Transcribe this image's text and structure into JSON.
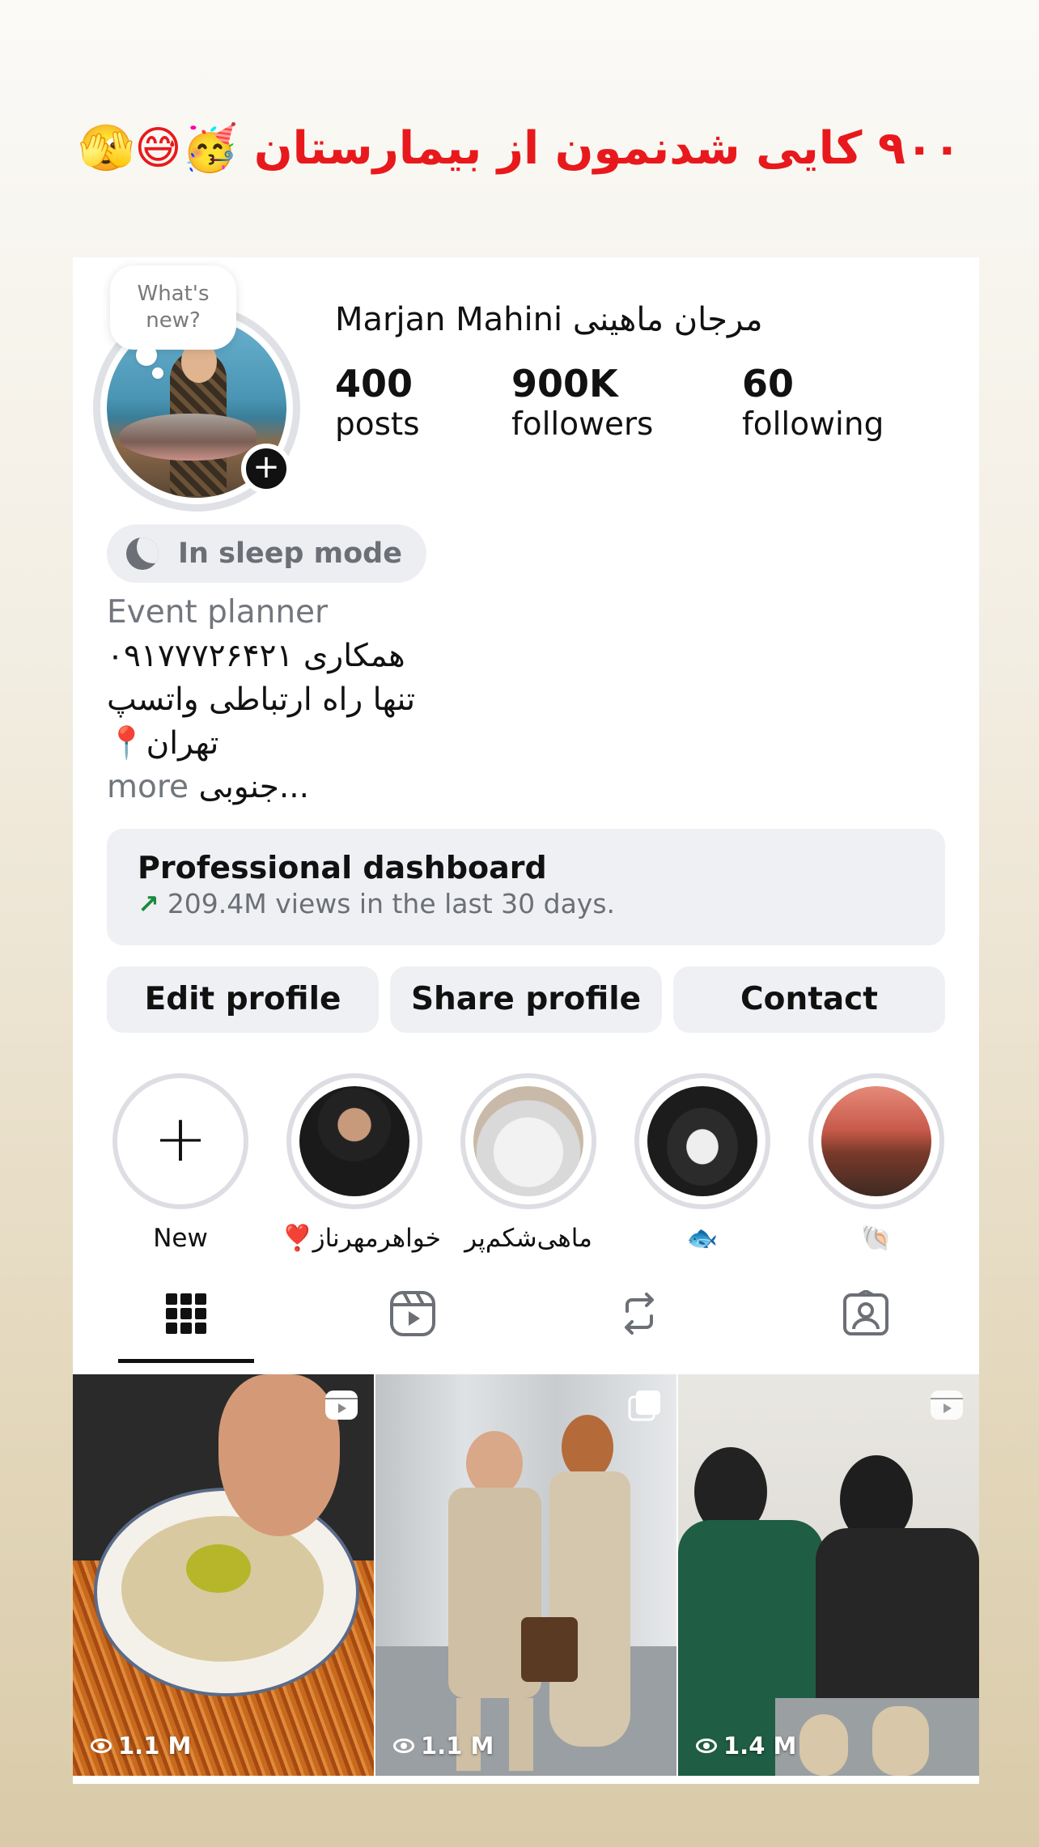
{
  "story": {
    "caption": "۹۰۰ کایی شدنمون از بیمارستان 🥳😅🫣"
  },
  "profile": {
    "note_text": "What's new?",
    "name": "Marjan Mahini مرجان ماهینی",
    "stats": [
      {
        "value": "400",
        "label": "posts"
      },
      {
        "value": "900K",
        "label": "followers"
      },
      {
        "value": "60",
        "label": "following"
      }
    ],
    "status": "In sleep mode",
    "category": "Event planner",
    "bio_lines": [
      "۰۹۱۷۷۷۲۶۴۲۱ همکاری",
      "تنها راه ارتباطی واتسپ",
      "📍تهران"
    ],
    "bio_last_line": "جنوبی...",
    "more_label": "more"
  },
  "dashboard": {
    "title": "Professional dashboard",
    "subtitle": "209.4M views in the last 30 days."
  },
  "actions": {
    "edit": "Edit profile",
    "share": "Share profile",
    "contact": "Contact"
  },
  "highlights": [
    {
      "label": "New"
    },
    {
      "label": "❣️خواهرمهرناز"
    },
    {
      "label": "ماهی‌شکم‌پر"
    },
    {
      "label": "🐟"
    },
    {
      "label": "🐚"
    }
  ],
  "tabs": [
    {
      "icon": "grid-icon",
      "active": true
    },
    {
      "icon": "reels-icon",
      "active": false
    },
    {
      "icon": "reposts-icon",
      "active": false
    },
    {
      "icon": "tagged-icon",
      "active": false
    }
  ],
  "posts": [
    {
      "views": "1.1 M",
      "type": "reel"
    },
    {
      "views": "1.1 M",
      "type": "carousel"
    },
    {
      "views": "1.4 M",
      "type": "reel"
    }
  ]
}
